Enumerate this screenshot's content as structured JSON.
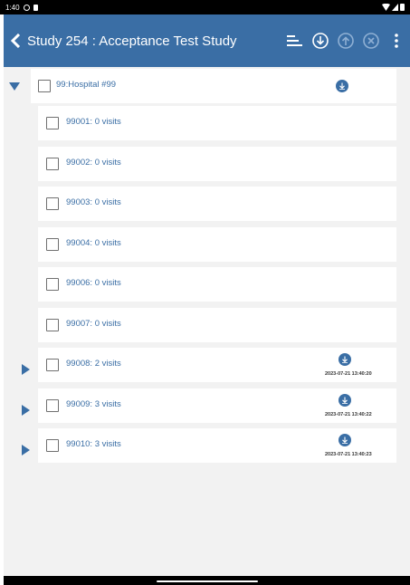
{
  "status_bar": {
    "time": "1:40"
  },
  "appbar": {
    "title": "Study 254 : Acceptance Test Study",
    "bg_color": "#3a6ea5"
  },
  "colors": {
    "accent": "#3a6ea5",
    "content_bg": "#f2f2f2"
  },
  "tree": {
    "parent": {
      "label": "99:Hospital #99",
      "expanded": true,
      "download_icon": "download-circle-icon"
    },
    "children": [
      {
        "label": "99001: 0 visits"
      },
      {
        "label": "99002: 0 visits"
      },
      {
        "label": "99003: 0 visits"
      },
      {
        "label": "99004: 0 visits"
      },
      {
        "label": "99006: 0 visits"
      },
      {
        "label": "99007: 0 visits"
      },
      {
        "label": "99008: 2 visits",
        "timestamp": "2023-07-21 13:40:20",
        "expandable": true
      },
      {
        "label": "99009: 3 visits",
        "timestamp": "2023-07-21 13:40:22",
        "expandable": true
      },
      {
        "label": "99010: 3 visits",
        "timestamp": "2023-07-21 13:40:23",
        "expandable": true
      }
    ]
  }
}
